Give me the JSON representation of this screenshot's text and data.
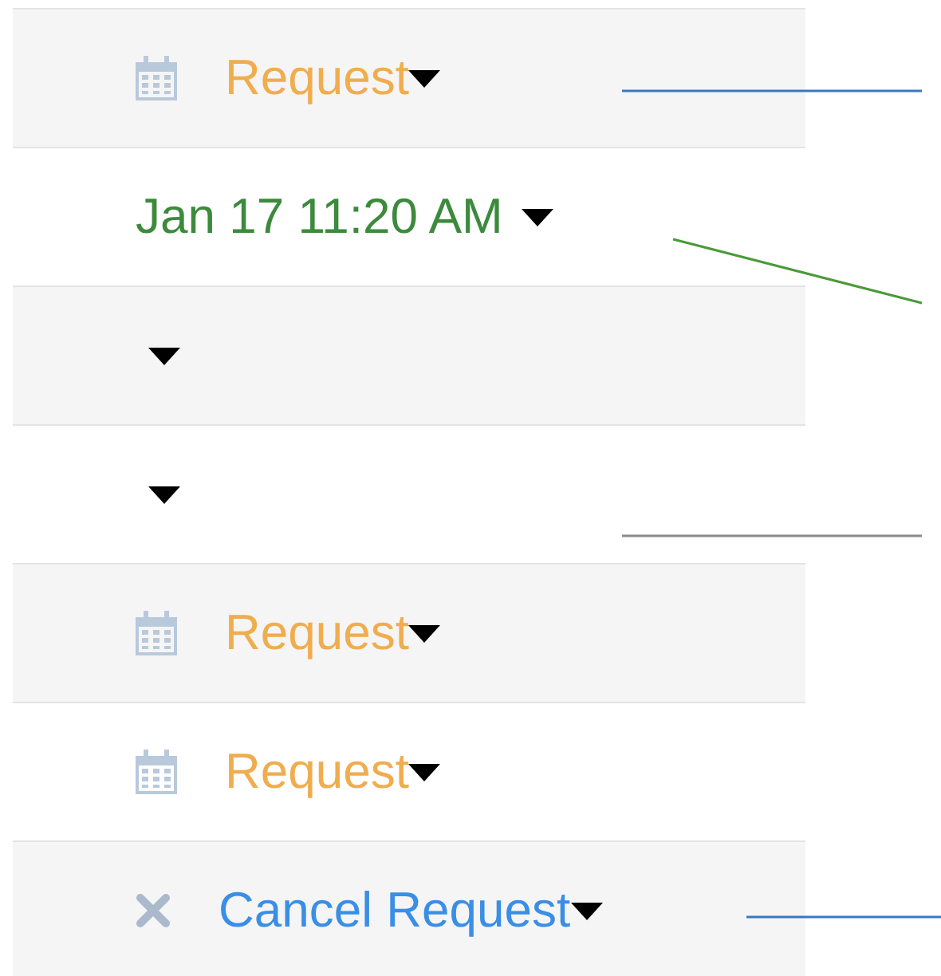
{
  "rows": [
    {
      "kind": "request",
      "label": "Request",
      "leader": {
        "color": "#3a78c2"
      }
    },
    {
      "kind": "date",
      "label": "Jan 17 11:20 AM",
      "leader": {
        "color": "#4a9a3a"
      }
    },
    {
      "kind": "empty"
    },
    {
      "kind": "empty",
      "leader": {
        "color": "#8a8a8a"
      }
    },
    {
      "kind": "request",
      "label": "Request"
    },
    {
      "kind": "request",
      "label": "Request"
    },
    {
      "kind": "cancel",
      "label": "Cancel Request",
      "leader": {
        "color": "#3a78c2"
      }
    }
  ]
}
